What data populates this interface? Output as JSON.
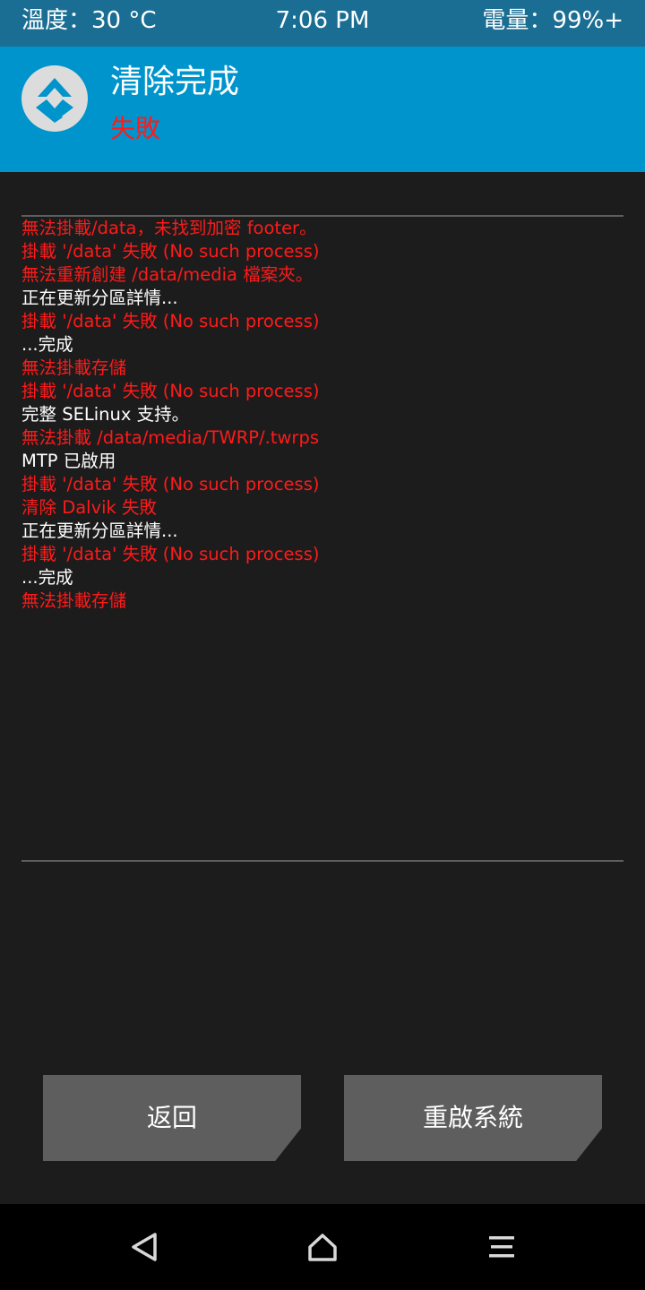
{
  "status_bar": {
    "temperature": "溫度：30 °C",
    "time": "7:06 PM",
    "battery": "電量：99%+"
  },
  "header": {
    "title": "清除完成",
    "subtitle": "失敗",
    "logo_icon": "twrp-logo-icon"
  },
  "console": {
    "lines": [
      {
        "text": "無法掛載/data，未找到加密 footer。",
        "type": "error"
      },
      {
        "text": "掛載 '/data' 失敗 (No such process)",
        "type": "error"
      },
      {
        "text": "無法重新創建 /data/media 檔案夾。",
        "type": "error"
      },
      {
        "text": "正在更新分區詳情...",
        "type": "info"
      },
      {
        "text": "掛載 '/data' 失敗 (No such process)",
        "type": "error"
      },
      {
        "text": "...完成",
        "type": "info"
      },
      {
        "text": "無法掛載存儲",
        "type": "error"
      },
      {
        "text": "掛載 '/data' 失敗 (No such process)",
        "type": "error"
      },
      {
        "text": "完整 SELinux 支持。",
        "type": "info"
      },
      {
        "text": "無法掛載 /data/media/TWRP/.twrps",
        "type": "error"
      },
      {
        "text": "MTP 已啟用",
        "type": "info"
      },
      {
        "text": "掛載 '/data' 失敗 (No such process)",
        "type": "error"
      },
      {
        "text": "清除 Dalvik 失敗",
        "type": "error"
      },
      {
        "text": "正在更新分區詳情...",
        "type": "info"
      },
      {
        "text": "掛載 '/data' 失敗 (No such process)",
        "type": "error"
      },
      {
        "text": "...完成",
        "type": "info"
      },
      {
        "text": "無法掛載存儲",
        "type": "error"
      }
    ]
  },
  "buttons": {
    "back_label": "返回",
    "reboot_label": "重啟系統"
  },
  "nav_bar": {
    "back_icon": "triangle-back-icon",
    "home_icon": "home-icon",
    "menu_icon": "menu-icon"
  },
  "colors": {
    "header_bg": "#0094cc",
    "status_bg": "#1b6e93",
    "error_text": "#ff1a1a",
    "info_text": "#ffffff",
    "button_bg": "#5e5e5e",
    "page_bg": "#1c1c1c"
  }
}
